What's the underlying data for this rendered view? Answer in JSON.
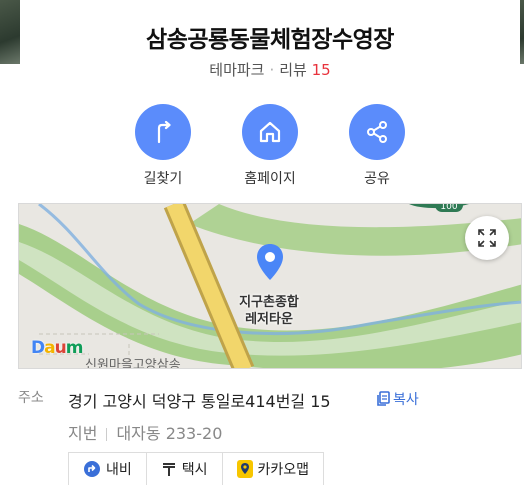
{
  "header": {
    "title": "삼송공룡동물체험장수영장",
    "category": "테마파크",
    "review_label": "리뷰",
    "review_count": "15"
  },
  "actions": [
    {
      "label": "길찾기",
      "icon": "directions-icon"
    },
    {
      "label": "홈페이지",
      "icon": "home-icon"
    },
    {
      "label": "공유",
      "icon": "share-icon"
    }
  ],
  "map": {
    "poi_line1": "지구촌종합",
    "poi_line2": "레저타운",
    "bottom_text": "신원마을고양삼송",
    "road_badge": "100",
    "logo": "Daum",
    "logo_colors": [
      "#4285f4",
      "#f4b400",
      "#db4437",
      "#0f9d58",
      "#4285f4"
    ]
  },
  "address": {
    "label": "주소",
    "road": "경기 고양시 덕양구 통일로414번길 15",
    "copy_label": "복사",
    "jibun_label": "지번",
    "jibun": "대자동 233-20"
  },
  "nav_buttons": [
    {
      "label": "내비",
      "icon": "navi-icon",
      "color": "#3a6fd8"
    },
    {
      "label": "택시",
      "icon": "taxi-icon",
      "color": "#333333"
    },
    {
      "label": "카카오맵",
      "icon": "kakaomap-icon",
      "color": "#f7c600"
    }
  ],
  "colors": {
    "accent": "#5b8cfb",
    "review_count": "#e8323c",
    "link": "#3a6fd8"
  }
}
